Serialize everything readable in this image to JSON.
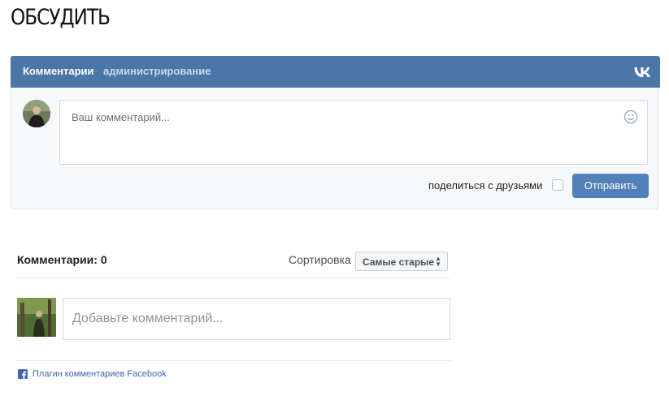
{
  "page": {
    "title": "ОБСУДИТЬ"
  },
  "vk": {
    "tabs": {
      "comments": "Комментарии",
      "separator": "·",
      "admin": "администрирование"
    },
    "logo_icon": "vk-logo-icon",
    "input": {
      "placeholder": "Ваш комментарий..."
    },
    "emoji_icon": "smiley-icon",
    "share_label": "поделиться с друзьями",
    "share_checked": false,
    "submit_label": "Отправить",
    "colors": {
      "header": "#4a76a8",
      "button": "#5181b8"
    }
  },
  "facebook": {
    "count_label": "Комментарии: 0",
    "sort_label": "Сортировка",
    "sort_value": "Самые старые",
    "input": {
      "placeholder": "Добавьте комментарий..."
    },
    "plugin_icon": "facebook-icon",
    "plugin_link": "Плагин комментариев Facebook",
    "colors": {
      "link": "#4267b2"
    }
  }
}
